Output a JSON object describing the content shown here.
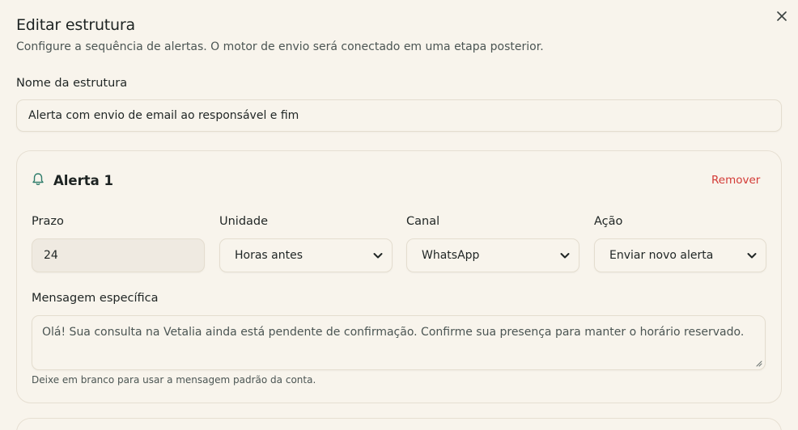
{
  "dialog": {
    "title": "Editar estrutura",
    "subtitle": "Configure a sequência de alertas. O motor de envio será conectado em uma etapa posterior.",
    "close_icon": "close-icon"
  },
  "structure_name": {
    "label": "Nome da estrutura",
    "value": "Alerta com envio de email ao responsável e fim"
  },
  "alert": {
    "icon": "bell-icon",
    "title": "Alerta 1",
    "remove_label": "Remover",
    "fields": {
      "prazo": {
        "label": "Prazo",
        "value": "24"
      },
      "unidade": {
        "label": "Unidade",
        "value": "Horas antes"
      },
      "canal": {
        "label": "Canal",
        "value": "WhatsApp"
      },
      "acao": {
        "label": "Ação",
        "value": "Enviar novo alerta"
      }
    },
    "message": {
      "label": "Mensagem específica",
      "value": "Olá! Sua consulta na Vetalia ainda está pendente de confirmação. Confirme sua presença para manter o horário reservado.",
      "hint": "Deixe em branco para usar a mensagem padrão da conta."
    }
  },
  "colors": {
    "background": "#f8f4ec",
    "accent": "#2f7d6b",
    "danger": "#d33a36",
    "border": "#e4ddcf"
  }
}
